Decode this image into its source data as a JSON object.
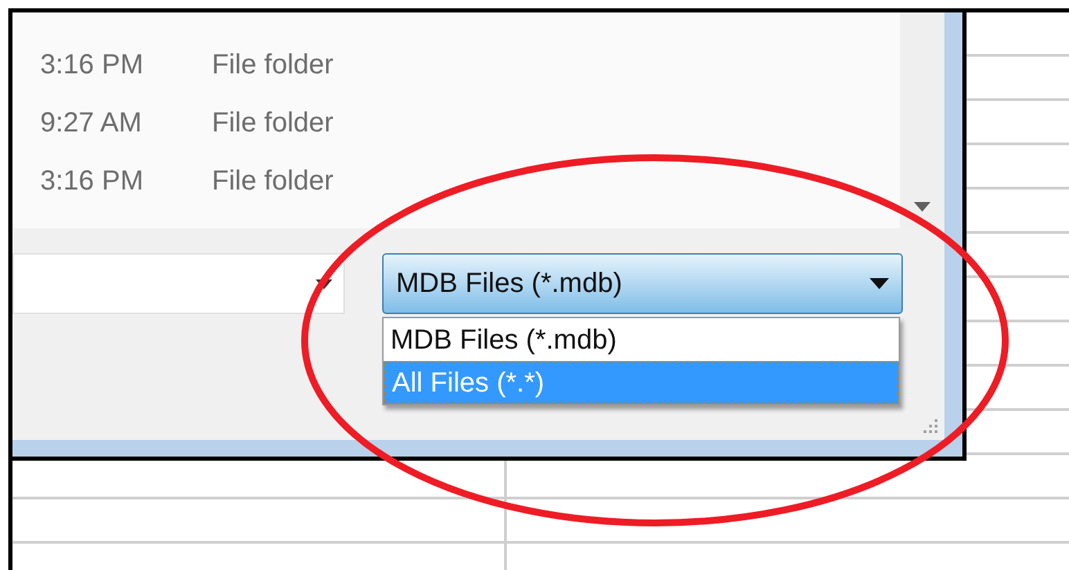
{
  "file_list": {
    "rows": [
      {
        "date_modified": "3:16 PM",
        "type": "File folder"
      },
      {
        "date_modified": "9:27 AM",
        "type": "File folder"
      },
      {
        "date_modified": "3:16 PM",
        "type": "File folder"
      }
    ]
  },
  "file_type_dropdown": {
    "value": "MDB Files (*.mdb)",
    "expanded": true,
    "options": [
      {
        "label": "MDB Files (*.mdb)",
        "highlighted": false
      },
      {
        "label": "All Files (*.*)",
        "highlighted": true
      }
    ]
  }
}
